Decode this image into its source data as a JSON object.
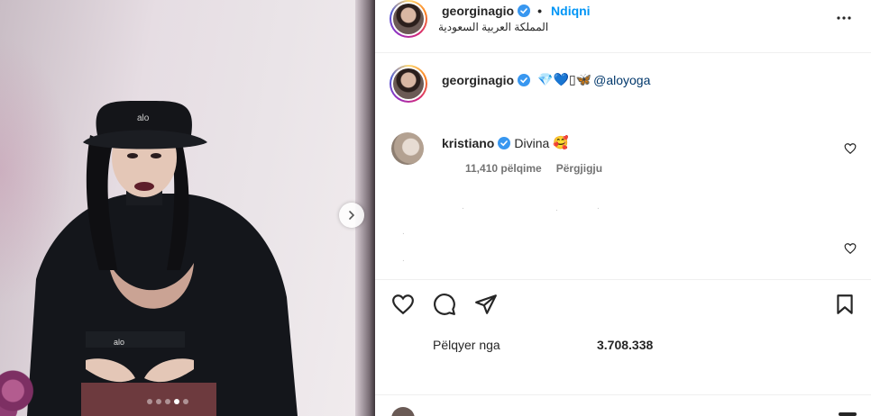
{
  "post": {
    "username": "georginagio",
    "follow_label": "Ndiqni",
    "separator": "•",
    "location": "المملكة العربية السعودية"
  },
  "caption": {
    "username": "georginagio",
    "emojis": "💎💙▯🦋",
    "mention": "@aloyoga"
  },
  "comment": {
    "username": "kristiano",
    "text": "Divina",
    "emoji": "🥰",
    "likes_label": "11,410 pëlqime",
    "reply_label": "Përgjigju"
  },
  "engagement": {
    "liked_by_label": "Pëlqyer nga",
    "likes_count": "3.708.338"
  },
  "carousel": {
    "total_slides": 5,
    "active_slide": 4
  },
  "colors": {
    "accent": "#0095f6",
    "verified": "#3897f0",
    "text": "#262626",
    "muted": "#737373"
  },
  "icons": {
    "more": "ellipsis-icon",
    "like": "heart-icon",
    "comment": "comment-icon",
    "share": "send-icon",
    "save": "bookmark-icon",
    "next": "chevron-right-icon"
  }
}
